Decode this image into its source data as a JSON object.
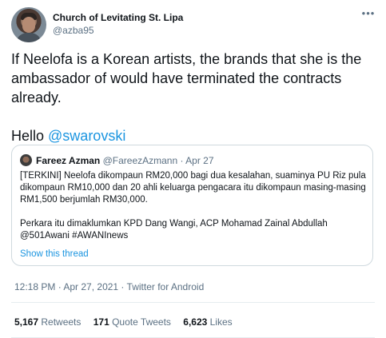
{
  "tweet": {
    "author_name": "Church of Levitating St. Lipa",
    "author_handle": "@azba95",
    "more_icon": "•••",
    "text_line": "If Neelofa is a Korean artists, the brands that she is the ambassador of would have terminated the contracts already.",
    "hello": "Hello ",
    "mention": "@swarovski",
    "timestamp": "12:18 PM · Apr 27, 2021 · Twitter for Android"
  },
  "quote": {
    "name": "Fareez Azman",
    "meta": " @FareezAzmann · Apr 27",
    "para1": "[TERKINI] Neelofa dikompaun RM20,000 bagi dua kesalahan, suaminya PU Riz pula dikompaun RM10,000 dan 20 ahli keluarga pengacara itu dikompaun masing-masing RM1,500 berjumlah RM30,000.",
    "para2": "Perkara itu dimaklumkan KPD Dang Wangi, ACP Mohamad Zainal Abdullah @501Awani #AWANInews",
    "show_thread": "Show this thread"
  },
  "stats": {
    "retweets_count": "5,167",
    "retweets_label": " Retweets",
    "quotes_count": "171",
    "quotes_label": " Quote Tweets",
    "likes_count": "6,623",
    "likes_label": " Likes"
  },
  "colors": {
    "link": "#1b95e0",
    "secondary_text": "#5b7083",
    "border": "#cfd9de"
  }
}
